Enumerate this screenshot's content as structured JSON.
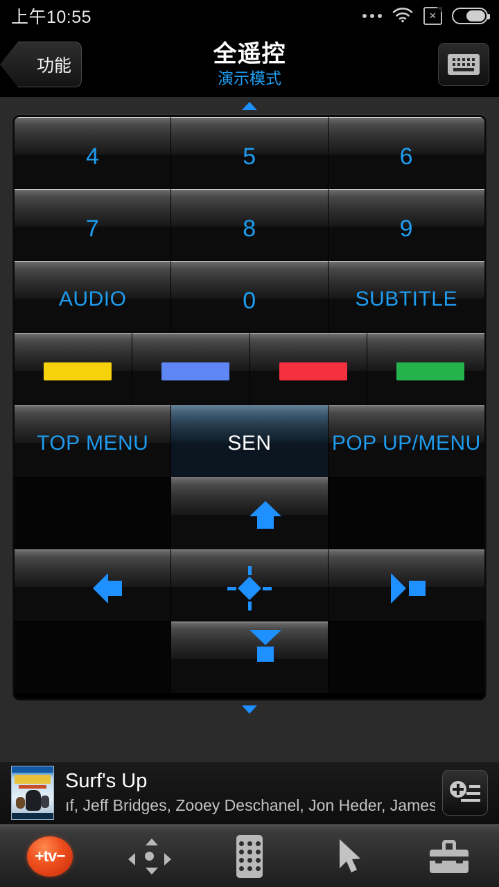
{
  "status_bar": {
    "time": "上午10:55",
    "icons": [
      "more-dots-icon",
      "wifi-icon",
      "sim-card-disabled-icon",
      "battery-icon"
    ]
  },
  "header": {
    "back_label": "功能",
    "title": "全遥控",
    "subtitle": "演示模式",
    "keyboard_icon": "keyboard-icon"
  },
  "remote": {
    "scroll_up_icon": "triangle-up-icon",
    "scroll_down_icon": "triangle-down-icon",
    "rows": {
      "numbers_1": [
        "4",
        "5",
        "6"
      ],
      "numbers_2": [
        "7",
        "8",
        "9"
      ],
      "numbers_3": [
        "AUDIO",
        "0",
        "SUBTITLE"
      ],
      "colors": [
        {
          "name": "yellow-color-key",
          "hex": "#f5d20c"
        },
        {
          "name": "blue-color-key",
          "hex": "#5f86f5"
        },
        {
          "name": "red-color-key",
          "hex": "#f5303f"
        },
        {
          "name": "green-color-key",
          "hex": "#24b24c"
        }
      ],
      "menus": [
        "TOP MENU",
        "SEN",
        "POP UP/MENU"
      ],
      "dpad": {
        "up": "arrow-up-icon",
        "left": "arrow-left-icon",
        "enter": "enter-diamond-icon",
        "right": "arrow-right-icon",
        "down": "arrow-down-icon"
      }
    }
  },
  "now_playing": {
    "cover_alt": "surfs-up-bluray-cover",
    "title": "Surf's Up",
    "cast": "ıf, Jeff Bridges, Zooey Deschanel, Jon Heder, James Wo",
    "add_button_icon": "add-to-list-icon"
  },
  "bottom_nav": [
    {
      "name": "nav-tv-sideview",
      "icon": "tv-logo-icon",
      "label": "+tv−"
    },
    {
      "name": "nav-dpad",
      "icon": "dpad-icon"
    },
    {
      "name": "nav-full-remote",
      "icon": "remote-keypad-icon"
    },
    {
      "name": "nav-pointer",
      "icon": "cursor-arrow-icon"
    },
    {
      "name": "nav-tools",
      "icon": "toolbox-icon"
    }
  ],
  "colors": {
    "accent_blue": "#1e9cf0",
    "background": "#2b2b2b",
    "panel": "#000000"
  }
}
